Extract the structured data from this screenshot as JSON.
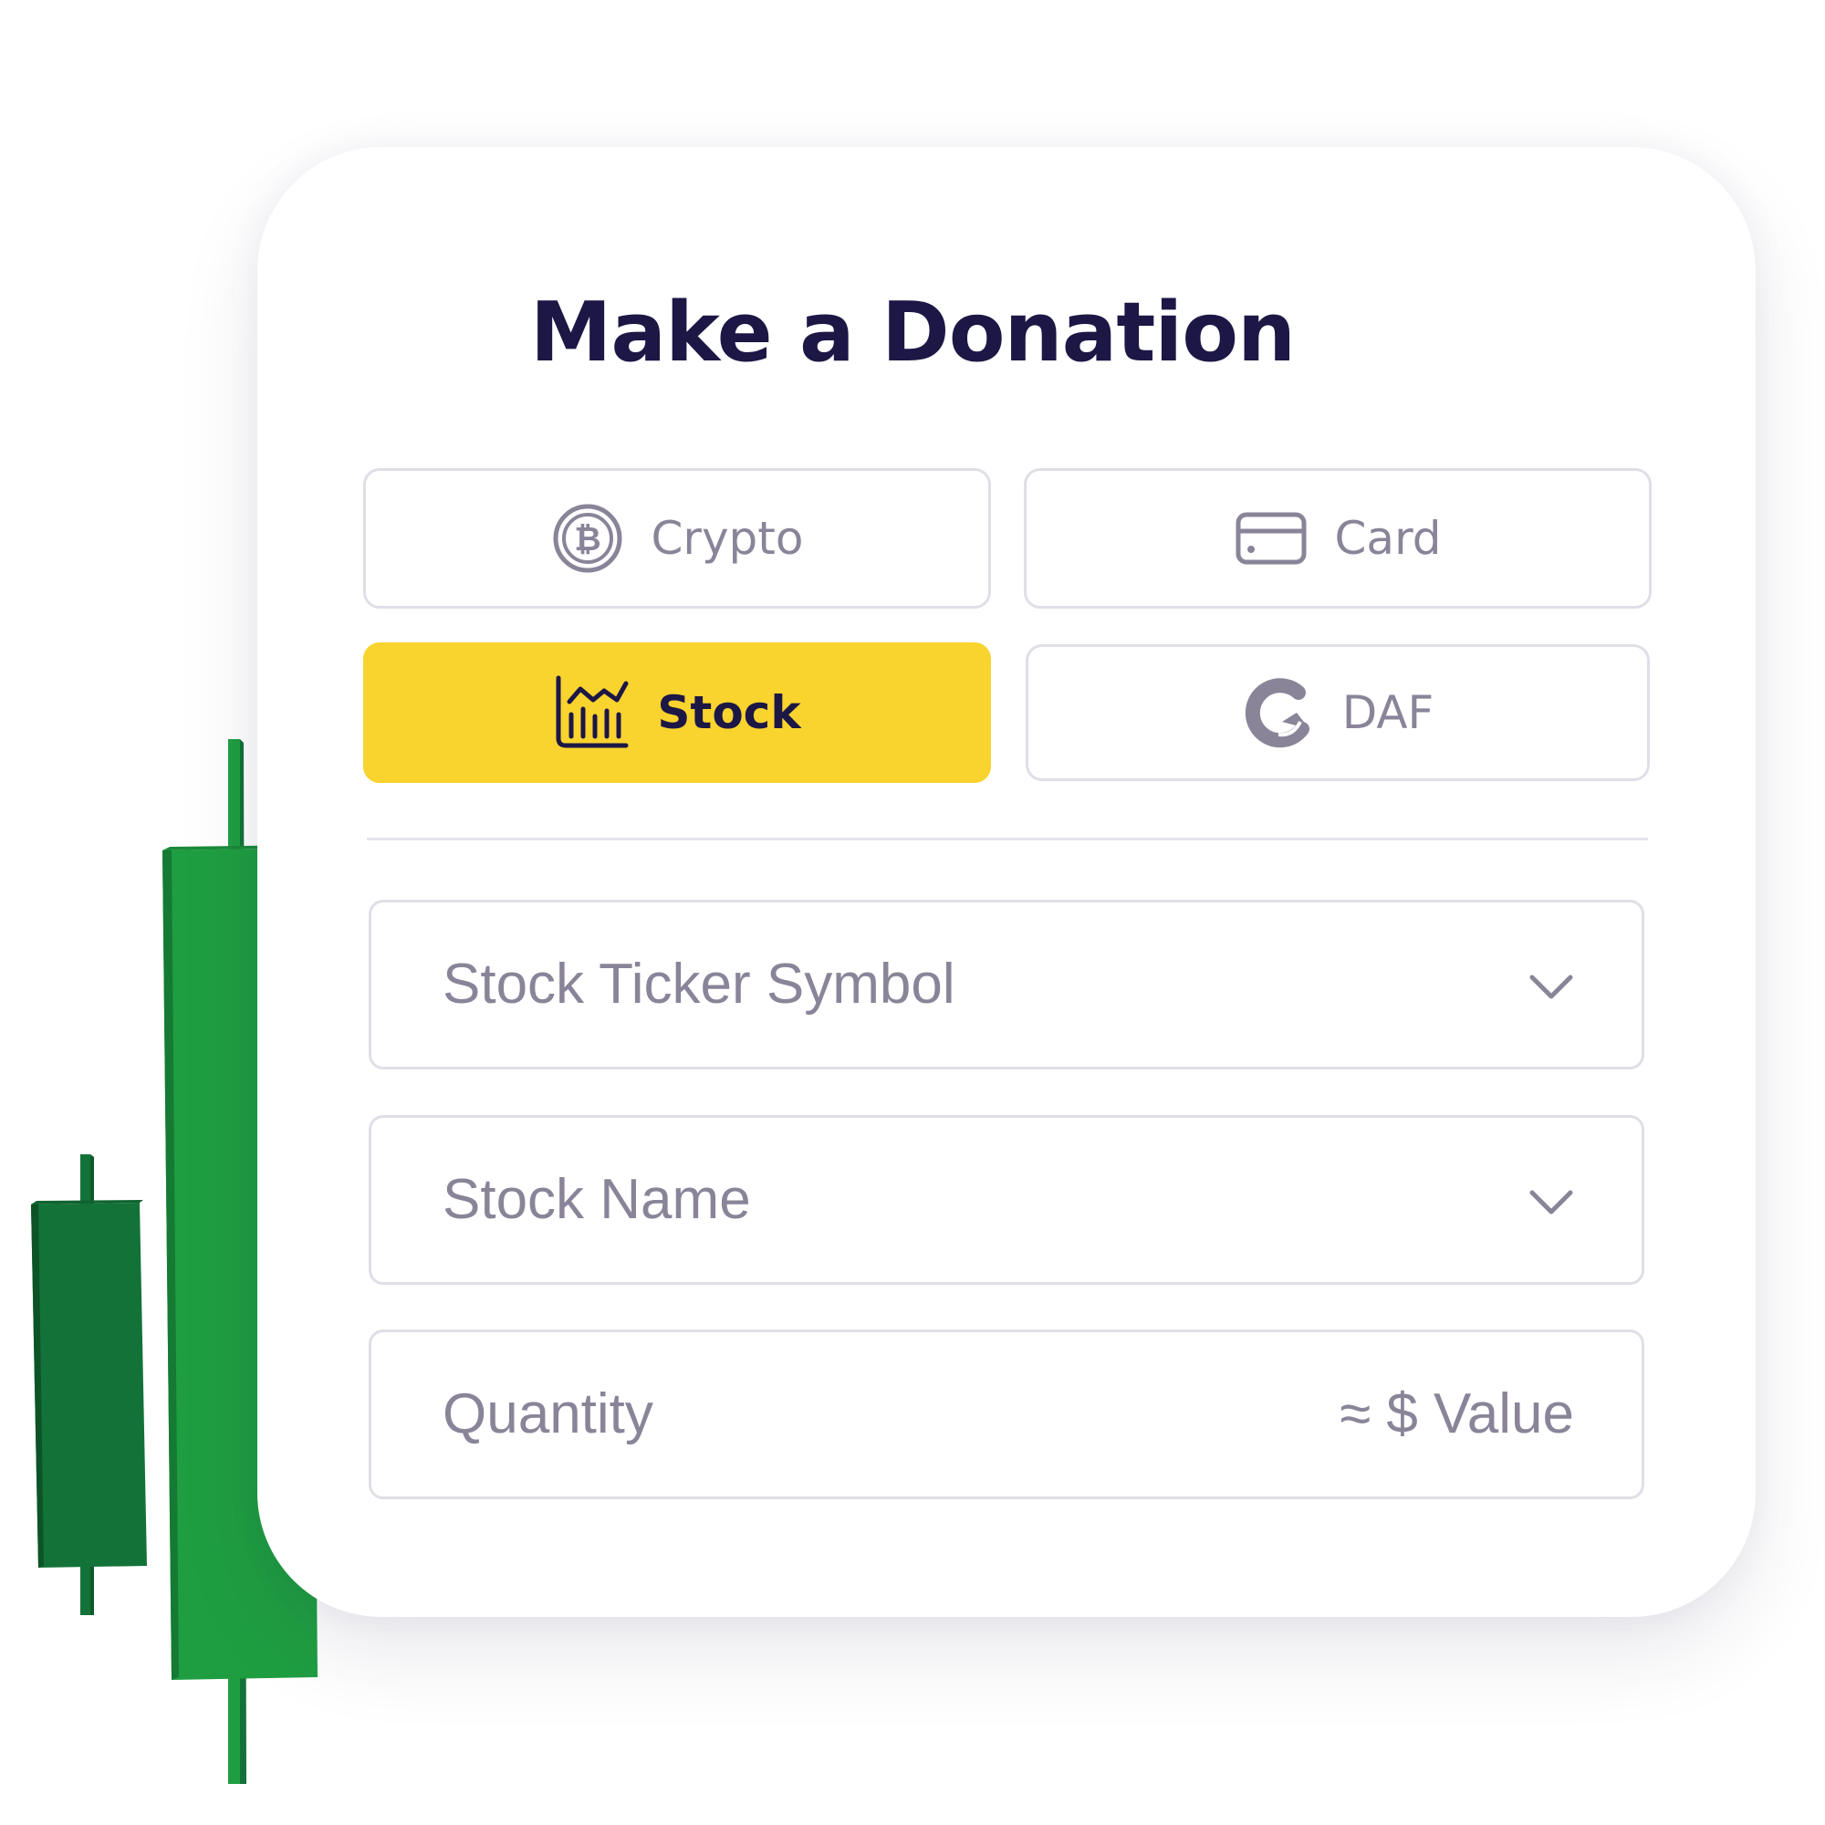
{
  "form": {
    "title": "Make a Donation",
    "methods": [
      {
        "label": "Crypto",
        "icon": "bitcoin-icon",
        "selected": false
      },
      {
        "label": "Card",
        "icon": "credit-card-icon",
        "selected": false
      },
      {
        "label": "Stock",
        "icon": "stock-chart-icon",
        "selected": true
      },
      {
        "label": "DAF",
        "icon": "daf-logo-icon",
        "selected": false
      }
    ],
    "fields": {
      "ticker_placeholder": "Stock Ticker Symbol",
      "name_placeholder": "Stock Name",
      "quantity_placeholder": "Quantity",
      "value_placeholder": "≈ $ Value"
    }
  },
  "colors": {
    "accent": "#f9d32e",
    "title": "#1c1745",
    "muted": "#8a8499",
    "candle_light": "#1f9e41",
    "candle_dark": "#137238"
  }
}
